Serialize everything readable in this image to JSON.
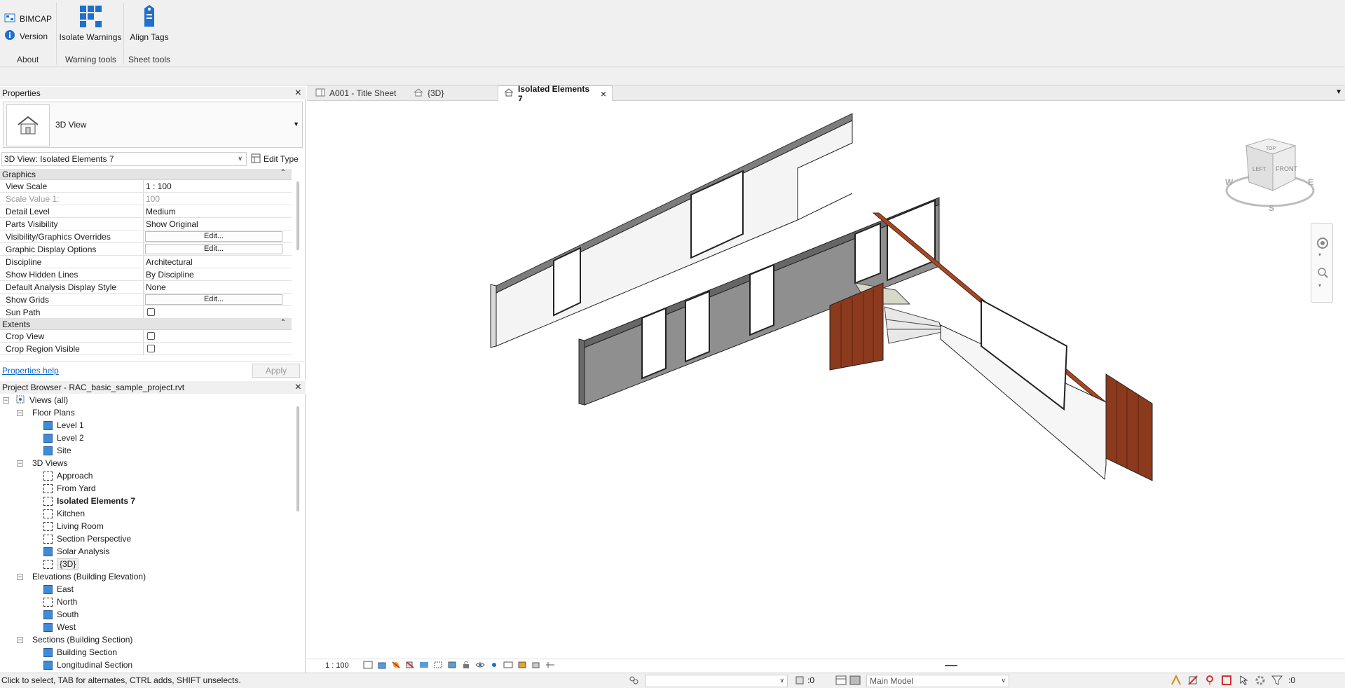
{
  "ribbon": {
    "bimcap": "BIMCAP",
    "version": "Version",
    "isolate_warnings": "Isolate Warnings",
    "align_tags": "Align Tags",
    "panel_about": "About",
    "panel_warning_tools": "Warning tools",
    "panel_sheet_tools": "Sheet tools"
  },
  "properties": {
    "title": "Properties",
    "type_name": "3D View",
    "instance": "3D View: Isolated Elements 7",
    "edit_type": "Edit Type",
    "groups": {
      "graphics": "Graphics",
      "extents": "Extents"
    },
    "rows": {
      "view_scale": {
        "k": "View Scale",
        "v": "1 : 100"
      },
      "scale_value": {
        "k": "Scale Value    1:",
        "v": "100"
      },
      "detail_level": {
        "k": "Detail Level",
        "v": "Medium"
      },
      "parts_visibility": {
        "k": "Parts Visibility",
        "v": "Show Original"
      },
      "vg_overrides": {
        "k": "Visibility/Graphics Overrides",
        "v": "Edit..."
      },
      "graphic_display": {
        "k": "Graphic Display Options",
        "v": "Edit..."
      },
      "discipline": {
        "k": "Discipline",
        "v": "Architectural"
      },
      "hidden_lines": {
        "k": "Show Hidden Lines",
        "v": "By Discipline"
      },
      "analysis_style": {
        "k": "Default Analysis Display Style",
        "v": "None"
      },
      "show_grids": {
        "k": "Show Grids",
        "v": "Edit..."
      },
      "sun_path": {
        "k": "Sun Path",
        "v": ""
      },
      "crop_view": {
        "k": "Crop View",
        "v": ""
      },
      "crop_region": {
        "k": "Crop Region Visible",
        "v": ""
      }
    },
    "help": "Properties help",
    "apply": "Apply"
  },
  "browser": {
    "title": "Project Browser - RAC_basic_sample_project.rvt",
    "views_all": "Views (all)",
    "floor_plans": "Floor Plans",
    "level1": "Level 1",
    "level2": "Level 2",
    "site": "Site",
    "views3d": "3D Views",
    "approach": "Approach",
    "from_yard": "From Yard",
    "isolated": "Isolated Elements 7",
    "kitchen": "Kitchen",
    "living_room": "Living Room",
    "section_persp": "Section Perspective",
    "solar": "Solar Analysis",
    "d3": "{3D}",
    "elevations": "Elevations (Building Elevation)",
    "east": "East",
    "north": "North",
    "south": "South",
    "west": "West",
    "sections": "Sections (Building Section)",
    "building_section": "Building Section",
    "longitudinal_section": "Longitudinal Section"
  },
  "tabs": {
    "title_sheet": "A001 - Title Sheet",
    "d3": "{3D}",
    "isolated": "Isolated Elements 7"
  },
  "viewcube": {
    "top": "TOP",
    "left": "LEFT",
    "front": "FRONT",
    "w": "W",
    "s": "S",
    "e": "E"
  },
  "viewbar": {
    "scale": "1 : 100"
  },
  "status": {
    "message": "Click to select, TAB for alternates, CTRL adds, SHIFT unselects.",
    "count_left": ":0",
    "model": "Main Model",
    "filter_count": ":0"
  },
  "colors": {
    "wall_gray": "#8f8f8f",
    "wood": "#8b3a1e",
    "accent_blue": "#1e6fd0"
  }
}
